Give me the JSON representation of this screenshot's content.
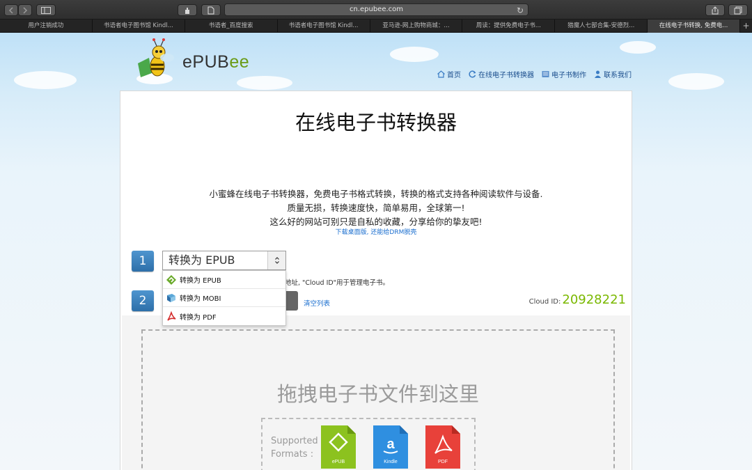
{
  "browser": {
    "url": "cn.epubee.com",
    "tabs": [
      {
        "label": "用户注销成功"
      },
      {
        "label": "书语者电子图书馆 Kindl..."
      },
      {
        "label": "书语者_百度搜索"
      },
      {
        "label": "书语者电子图书馆 Kindl..."
      },
      {
        "label": "亚马逊-网上购物商城：..."
      },
      {
        "label": "周读：提供免费电子书..."
      },
      {
        "label": "猎魔人七部合集-安德烈..."
      },
      {
        "label": "在线电子书转换, 免费电..."
      }
    ],
    "new_tab": "+"
  },
  "site": {
    "logo_text_e": "e",
    "logo_text_pub": "PUB",
    "logo_text_ee": "ee",
    "nav": [
      {
        "label": "首页",
        "icon": "home-icon"
      },
      {
        "label": "在线电子书转换器",
        "icon": "refresh-icon"
      },
      {
        "label": "电子书制作",
        "icon": "book-icon"
      },
      {
        "label": "联系我们",
        "icon": "person-icon"
      }
    ]
  },
  "main": {
    "title": "在线电子书转换器",
    "desc_line1": "小蜜蜂在线电子书转换器，免费电子书格式转换，转换的格式支持各种阅读软件与设备.",
    "desc_line2": "质量无损，转换速度快，简单易用，全球第一!",
    "desc_line3": "这么好的网站可别只是自私的收藏，分享给你的挚友吧!",
    "link_desktop": "下载桌面版",
    "link_sep": ",",
    "link_drm": "还能给DRM脱壳",
    "step1": "1",
    "step2": "2",
    "select_value": "转换为 EPUB",
    "select_arrow": "⌃⌄",
    "dropdown_options": [
      "转换为 EPUB",
      "转换为 MOBI",
      "转换为 PDF"
    ],
    "hint": "地址, \"Cloud ID\"用于管理电子书。",
    "clear_list": "清空列表",
    "cloud_id_label": "Cloud ID:",
    "cloud_id_value": "20928221",
    "drop_text": "拖拽电子书文件到这里",
    "supported_line1": "Supported",
    "supported_line2": "Formats :",
    "formats": [
      {
        "label": "ePUB",
        "color": "#8cc21f"
      },
      {
        "label": "Kindle",
        "color": "#2f8fe0"
      },
      {
        "label": "PDF",
        "color": "#e8413a"
      }
    ]
  }
}
